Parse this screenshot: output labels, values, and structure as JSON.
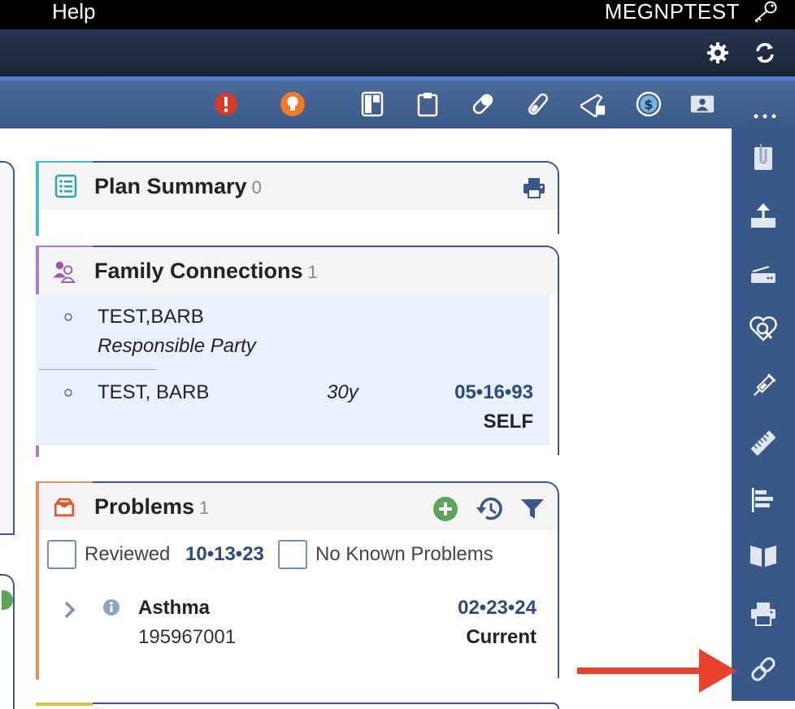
{
  "topbar": {
    "help": "Help",
    "username": "MEGNPTEST"
  },
  "colors": {
    "accent_blue": "#3a5887",
    "date_blue": "#2c4a7c",
    "plan_teal": "#4bb8c4",
    "family_purple": "#b07ec0",
    "problems_orange": "#ef8b63",
    "alert_red": "#d63a2a",
    "bulb_orange": "#f07a2a",
    "add_green": "#5aa55a",
    "arrow_red": "#e8412c"
  },
  "band2_icons": [
    "gear-icon",
    "refresh-icon"
  ],
  "toolbar_icons": [
    "alert-icon",
    "lightbulb-icon",
    "layout-icon",
    "clipboard-icon",
    "pill-icon",
    "test-tube-icon",
    "flask-icon",
    "dollar-icon",
    "id-card-icon",
    "more-icon"
  ],
  "plan_summary": {
    "title": "Plan Summary",
    "count": "0"
  },
  "family": {
    "title": "Family Connections",
    "count": "1",
    "entries": [
      {
        "name": "TEST,BARB",
        "role": "Responsible Party"
      },
      {
        "name": "TEST, BARB",
        "age": "30y",
        "dob": "05•16•93",
        "relation": "SELF"
      }
    ]
  },
  "problems": {
    "title": "Problems",
    "count": "1",
    "reviewed_label": "Reviewed",
    "reviewed_date": "10•13•23",
    "no_known_label": "No Known Problems",
    "items": [
      {
        "name": "Asthma",
        "code": "195967001",
        "date": "02•23•24",
        "status": "Current"
      }
    ]
  },
  "sidebar_icons": [
    "paperclip-icon",
    "upload-icon",
    "scanner-icon",
    "heart-search-icon",
    "syringe-icon",
    "ruler-icon",
    "bar-chart-icon",
    "book-icon",
    "printer-icon",
    "link-icon"
  ]
}
